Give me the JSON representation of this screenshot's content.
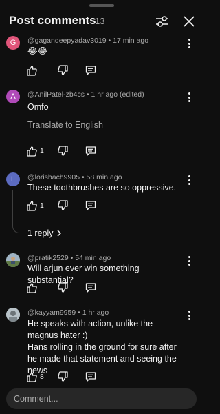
{
  "header": {
    "title": "Post comments",
    "count": "13",
    "filter_icon": "sliders-icon",
    "close_icon": "close-icon"
  },
  "comments": [
    {
      "avatar_letter": "G",
      "avatar_color": "#e0557a",
      "meta": "@gagandeepyadav3019 • 17 min ago",
      "text": "😂😂",
      "likes": ""
    },
    {
      "avatar_letter": "A",
      "avatar_color": "#b04ab8",
      "meta": "@AnilPatel-zb4cs • 1 hr ago (edited)",
      "text": "Omfo",
      "translate": "Translate to English",
      "likes": "1"
    },
    {
      "avatar_letter": "L",
      "avatar_color": "#5c6bc0",
      "meta": "@lorisbach9905 • 58 min ago",
      "text": "These toothbrushes are so oppressive.",
      "likes": "1",
      "replies": "1 reply"
    },
    {
      "avatar_letter": "",
      "avatar_color": "#6f8a5a",
      "meta": "@pratik2529 • 54 min ago",
      "text": "Will arjun ever win something substantial?",
      "likes": ""
    },
    {
      "avatar_letter": "",
      "avatar_color": "#9aa4ab",
      "meta": "@kayyam9959 • 1 hr ago",
      "text": "He speaks with action, unlike the magnus hater :)",
      "text2": "Hans rolling in the ground for sure after he made that statement and seeing the news",
      "likes": "8"
    }
  ],
  "composer": {
    "placeholder": "Comment..."
  }
}
